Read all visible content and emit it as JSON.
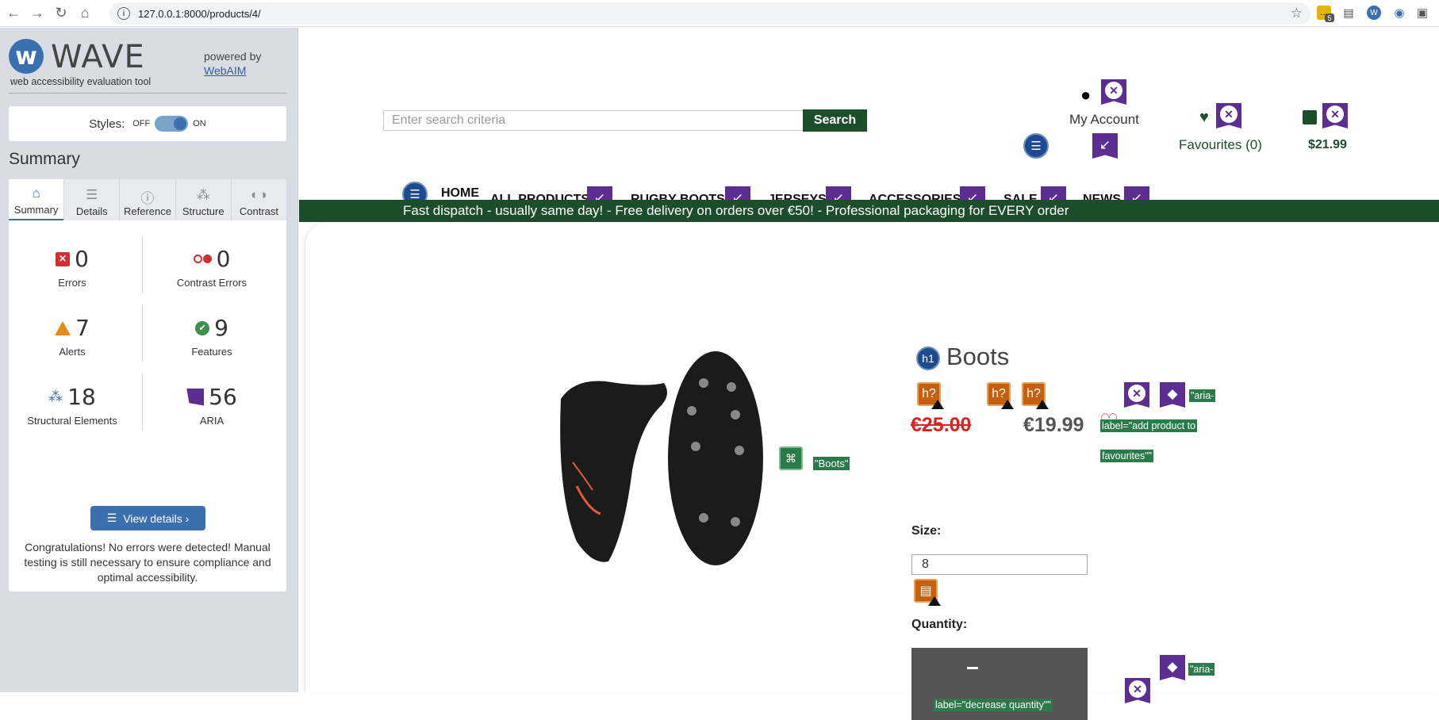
{
  "browser": {
    "url": "127.0.0.1:8000/products/4/",
    "ext_badge": "5"
  },
  "wave": {
    "title": "WAVE",
    "subtitle": "web accessibility evaluation tool",
    "powered_by": "powered by",
    "webaim": "WebAIM",
    "styles_label": "Styles:",
    "toggle_off": "OFF",
    "toggle_on": "ON",
    "summary_heading": "Summary",
    "tabs": [
      {
        "label": "Summary",
        "icon": "home-icon"
      },
      {
        "label": "Details",
        "icon": "list-icon"
      },
      {
        "label": "Reference",
        "icon": "info-icon"
      },
      {
        "label": "Structure",
        "icon": "hierarchy-icon"
      },
      {
        "label": "Contrast",
        "icon": "contrast-icon"
      }
    ],
    "stats": {
      "errors": {
        "value": "0",
        "label": "Errors"
      },
      "contrast": {
        "value": "0",
        "label": "Contrast Errors"
      },
      "alerts": {
        "value": "7",
        "label": "Alerts"
      },
      "features": {
        "value": "9",
        "label": "Features"
      },
      "structural": {
        "value": "18",
        "label": "Structural Elements"
      },
      "aria": {
        "value": "56",
        "label": "ARIA"
      }
    },
    "view_details": "View details ›",
    "congrats": "Congratulations! No errors were detected! Manual testing is still necessary to ensure compliance and optimal accessibility."
  },
  "site": {
    "search_placeholder": "Enter search criteria",
    "search_button": "Search",
    "account_label": "My Account",
    "favourites_label": "Favourites (0)",
    "cart_total": "$21.99",
    "nav": [
      "HOME",
      "ALL PRODUCTS",
      "RUGBY BOOTS",
      "JERSEYS",
      "ACCESSORIES",
      "SALE",
      "NEWS"
    ],
    "banner": "Fast dispatch - usually same day! - Free delivery on orders over €50! - Professional packaging for EVERY order",
    "image_alt_label": "\"Boots\"",
    "h1_badge": "h1",
    "product_title": "Boots",
    "hq_label": "h?",
    "old_price": "€25.00",
    "new_price": "€19.99",
    "fav_aria_1": "\"aria-",
    "fav_aria_2": "label=\"add product to",
    "fav_aria_3": "favourites\"\"",
    "size_label": "Size:",
    "size_value": "8",
    "quantity_label": "Quantity:",
    "qty_aria_1": "\"aria-",
    "qty_aria_2": "label=\"decrease quantity\"\""
  },
  "colors": {
    "brand_green": "#1d4e2c",
    "wave_blue": "#3a70b0",
    "aria_purple": "#5c2e91",
    "alert_orange": "#c5610e"
  }
}
